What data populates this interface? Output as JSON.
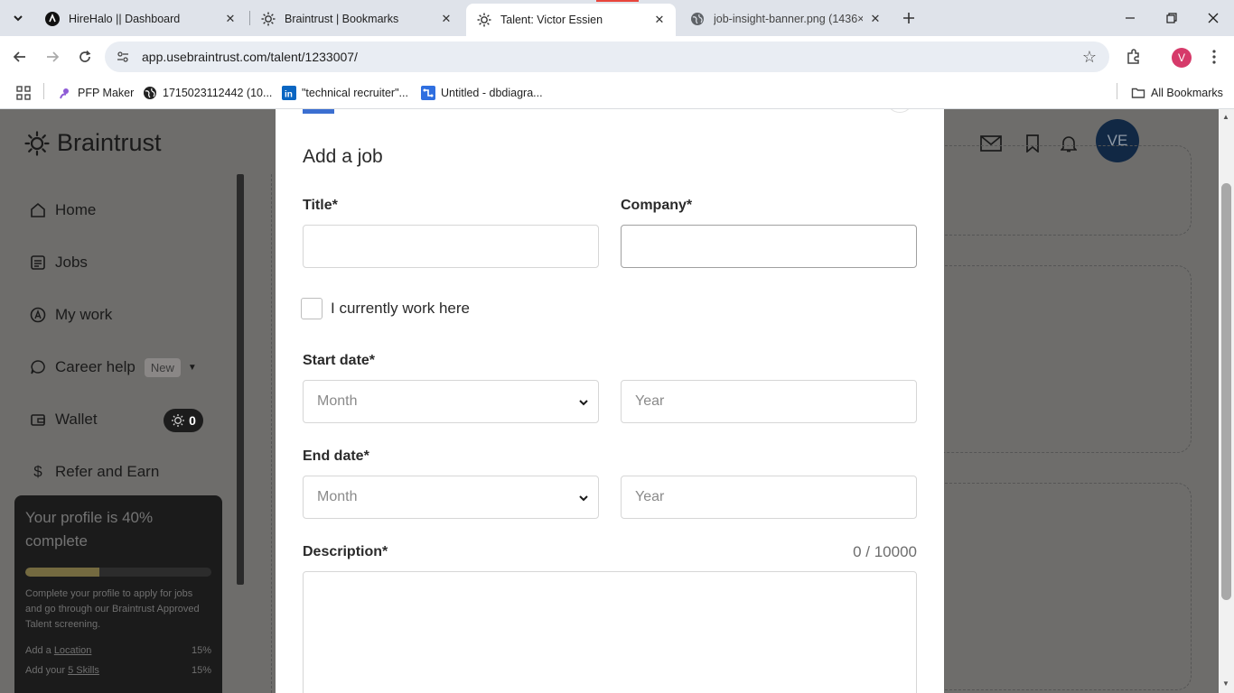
{
  "browser": {
    "tabs": [
      {
        "title": "HireHalo || Dashboard",
        "icon": "hirehalo-icon",
        "active": false
      },
      {
        "title": "Braintrust | Bookmarks",
        "icon": "braintrust-icon",
        "active": false
      },
      {
        "title": "Talent: Victor Essien",
        "icon": "braintrust-icon",
        "active": true
      },
      {
        "title": "job-insight-banner.png (1436×",
        "icon": "globe-icon",
        "active": false
      }
    ],
    "url": "app.usebraintrust.com/talent/1233007/",
    "profile_initial": "V",
    "bookmarks": [
      {
        "label": "PFP Maker",
        "icon": "pfp-maker-icon"
      },
      {
        "label": "1715023112442 (10...",
        "icon": "globe-icon"
      },
      {
        "label": "\"technical recruiter\"...",
        "icon": "linkedin-icon"
      },
      {
        "label": "Untitled - dbdiagra...",
        "icon": "dbdiagram-icon"
      }
    ],
    "all_bookmarks_label": "All Bookmarks"
  },
  "app": {
    "brand": "Braintrust",
    "nav": [
      {
        "label": "Home",
        "icon": "home-icon"
      },
      {
        "label": "Jobs",
        "icon": "jobs-icon"
      },
      {
        "label": "My work",
        "icon": "my-work-icon"
      },
      {
        "label": "Career help",
        "icon": "chat-bubble-icon",
        "badge": "New"
      },
      {
        "label": "Wallet",
        "icon": "wallet-icon",
        "balance": "0"
      },
      {
        "label": "Refer and Earn",
        "icon": "dollar-icon"
      }
    ],
    "profile_card": {
      "title": "Your profile is 40% complete",
      "progress": 0.4,
      "description": "Complete your profile to apply for jobs and go through our Braintrust Approved Talent screening.",
      "tasks": [
        {
          "prefix": "Add a ",
          "link": "Location",
          "percent": "15%"
        },
        {
          "prefix": "Add your ",
          "link": "5 Skills",
          "percent": "15%"
        }
      ]
    },
    "user_initials": "VE"
  },
  "modal": {
    "heading": "Add a job",
    "title_label": "Title*",
    "title_value": "",
    "company_label": "Company*",
    "company_value": "",
    "current_job_label": "I currently work here",
    "start_date_label": "Start date*",
    "start_month_placeholder": "Month",
    "start_year_placeholder": "Year",
    "end_date_label": "End date*",
    "end_month_placeholder": "Month",
    "end_year_placeholder": "Year",
    "description_label": "Description*",
    "description_counter": "0 / 10000",
    "description_value": ""
  },
  "colors": {
    "accent_blue": "#3b6fd1",
    "overlay": "#6e6d6b",
    "avatar_bg": "#112844"
  }
}
